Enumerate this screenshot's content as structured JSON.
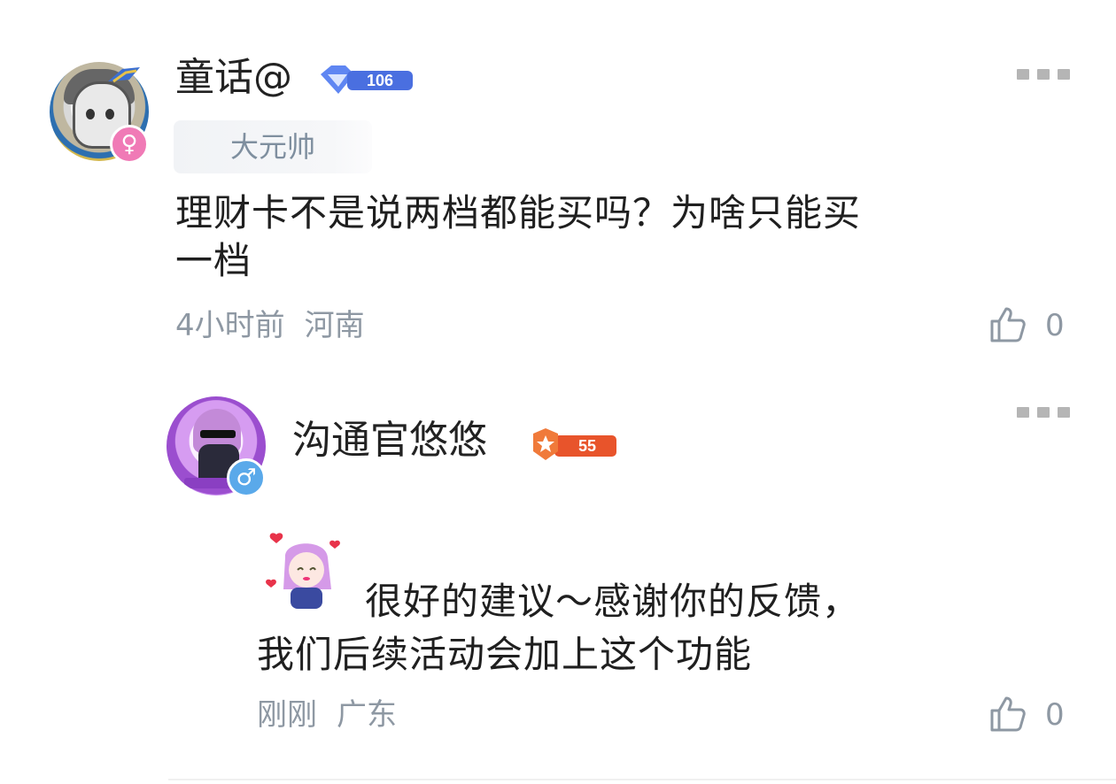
{
  "comments": [
    {
      "username": "童话@",
      "rank_badge": "106",
      "title_tag": "大元帅",
      "gender": "♀",
      "text": "理财卡不是说两档都能买吗？为啥只能买一档",
      "text_line1": "理财卡不是说两档都能买吗？为啥只能买",
      "text_line2": "一档",
      "time": "4小时前",
      "location": "河南",
      "likes": "0"
    }
  ],
  "reply": {
    "username": "沟通官悠悠",
    "rank_badge": "55",
    "gender": "♂",
    "text_line1": "很好的建议～感谢你的反馈，",
    "text_line2": "我们后续活动会加上这个功能",
    "time": "刚刚",
    "location": "广东",
    "likes": "0"
  },
  "colors": {
    "meta_text": "#8e98a3",
    "title_tag_text": "#7f8f9f",
    "female_badge": "#f07ab6",
    "male_badge": "#5aa9ea",
    "rank_blue": "#4a6fe0",
    "rank_orange": "#e8542b"
  },
  "icons": {
    "more": "more-dots-icon",
    "like": "thumbs-up-icon"
  }
}
